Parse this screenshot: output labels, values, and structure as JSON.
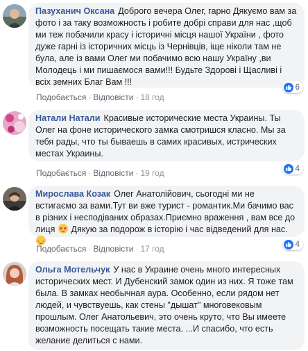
{
  "colors": {
    "author": "#385898",
    "bubble": "#f2f3f5",
    "meta": "#606770",
    "like": "#1877f2"
  },
  "actions": {
    "like_label": "Подобається",
    "reply_label": "Відповісти",
    "separator": "·"
  },
  "comments": [
    {
      "author": "Пазуханич Оксана",
      "text": "Доброго вечера Олег, гарно Дякуємо вам за фото і за таку возможность і робите добрі справи для нас ,щоб ми теж побачили красу і історичні місця нашої України , фото дуже гарні із історичних місць із Чернівців, іще ніколи там не була, але із вами Олег ми побачимо всю нашу Україну ,ви Молодець і ми пишаємося вами!!! Будьте Здорові і Щасливі і всіх земних Благ Вам !!!",
      "time": "18 год",
      "reactions": "6",
      "avatar_icon": "profile-photo"
    },
    {
      "author": "Натали Натали",
      "text": "Красивые исторические места Украины. Ты Олег на фоне исторического замка смотришся класно. Мы за тебя рады, что ты бываешь в самих красивых, истрических местах Украины.",
      "time": "19 год",
      "reactions": "4",
      "avatar_icon": "profile-photo"
    },
    {
      "author": "Мирослава Козак",
      "text_before_emoji": "Олег Анатолійович, сьогодні ми не встигаємо за вами.Тут ви вже турист - романтик.Ми бачимо вас в різних і несподіваних образах.Приємно враження , вам все до лиця",
      "text_after_emoji": "Дякую за подорож в історію і час відведений для нас.",
      "emoji_1": "heart-eyes-emoji",
      "emoji_2": "blush-emoji",
      "time": "17 год",
      "reactions": "4",
      "avatar_icon": "profile-photo"
    },
    {
      "author": "Ольга Мотельчук",
      "text": "У нас в Украине очень много интересных исторических мест. И Дубенский замок один из них. Я тоже там была. В замках необычная аура. Особенно, если рядом нет людей, и чувствуешь, как стены \"дышат\" многовековым прошлым. Олег Анатольевич, это очень круто, что Вы имеете возможность посещать такие места. ...И спасибо, что есть желание делиться с нами.",
      "avatar_icon": "profile-photo"
    }
  ]
}
